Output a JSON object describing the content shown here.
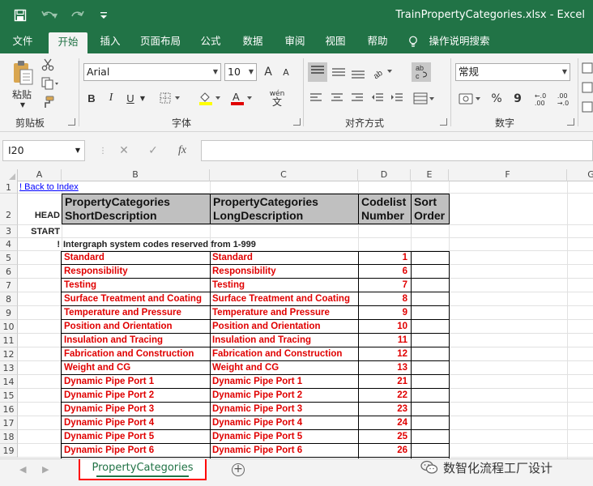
{
  "title_bar": {
    "doc_title": "TrainPropertyCategories.xlsx  -  Excel"
  },
  "ribbon_tabs": [
    "文件",
    "开始",
    "插入",
    "页面布局",
    "公式",
    "数据",
    "审阅",
    "视图",
    "帮助",
    "操作说明搜索"
  ],
  "active_tab": "开始",
  "ribbon": {
    "paste_label": "粘贴",
    "groups": {
      "clipboard": "剪贴板",
      "font": "字体",
      "alignment": "对齐方式",
      "number": "数字"
    },
    "font_name": "Arial",
    "font_size": "10",
    "bold": "B",
    "italic": "I",
    "underline": "U",
    "wen": "wén",
    "number_format": "常规",
    "percent": "%",
    "comma": "9",
    "increase_decimal": "←.0\n.00",
    "decrease_decimal": ".00\n→.0",
    "grow_font": "A",
    "shrink_font": "A",
    "wrap_label": "ab\nc"
  },
  "formula_bar": {
    "name_box": "I20",
    "fx": "fx",
    "formula_value": ""
  },
  "sheet": {
    "columns": [
      "A",
      "B",
      "C",
      "D",
      "E",
      "F",
      "G"
    ],
    "rows": [
      "1",
      "2",
      "3",
      "4",
      "5",
      "6",
      "7",
      "8",
      "9",
      "10",
      "11",
      "12",
      "13",
      "14",
      "15",
      "16",
      "17",
      "18",
      "19"
    ],
    "a1_link": "! Back to Index",
    "a2": "HEAD",
    "a3": "START",
    "a4": "!",
    "header": {
      "b": "PropertyCategories\nShortDescription",
      "c": "PropertyCategories\nLongDescription",
      "d": "Codelist\nNumber",
      "e": "Sort\nOrder"
    },
    "b4": "Intergraph system codes reserved from 1-999",
    "data_rows": [
      {
        "short": "Standard",
        "long": "Standard",
        "num": "1"
      },
      {
        "short": "Responsibility",
        "long": "Responsibility",
        "num": "6"
      },
      {
        "short": "Testing",
        "long": "Testing",
        "num": "7"
      },
      {
        "short": "Surface Treatment and Coating",
        "long": "Surface Treatment and Coating",
        "num": "8"
      },
      {
        "short": "Temperature and Pressure",
        "long": "Temperature and Pressure",
        "num": "9"
      },
      {
        "short": "Position and Orientation",
        "long": "Position and Orientation",
        "num": "10"
      },
      {
        "short": "Insulation and Tracing",
        "long": "Insulation and Tracing",
        "num": "11"
      },
      {
        "short": "Fabrication and Construction",
        "long": "Fabrication and Construction",
        "num": "12"
      },
      {
        "short": "Weight and CG",
        "long": "Weight and CG",
        "num": "13"
      },
      {
        "short": "Dynamic Pipe Port 1",
        "long": "Dynamic Pipe Port 1",
        "num": "21"
      },
      {
        "short": "Dynamic Pipe Port 2",
        "long": "Dynamic Pipe Port 2",
        "num": "22"
      },
      {
        "short": "Dynamic Pipe Port 3",
        "long": "Dynamic Pipe Port 3",
        "num": "23"
      },
      {
        "short": "Dynamic Pipe Port 4",
        "long": "Dynamic Pipe Port 4",
        "num": "24"
      },
      {
        "short": "Dynamic Pipe Port 5",
        "long": "Dynamic Pipe Port 5",
        "num": "25"
      },
      {
        "short": "Dynamic Pipe Port 6",
        "long": "Dynamic Pipe Port 6",
        "num": "26"
      }
    ]
  },
  "sheet_tabs": {
    "active": "PropertyCategories",
    "add": "+"
  },
  "watermark": "数智化流程工厂设计",
  "colors": {
    "excel_green": "#217346",
    "data_red": "#e00000",
    "header_gray": "#c0c0c0",
    "link_blue": "#0000ff"
  }
}
